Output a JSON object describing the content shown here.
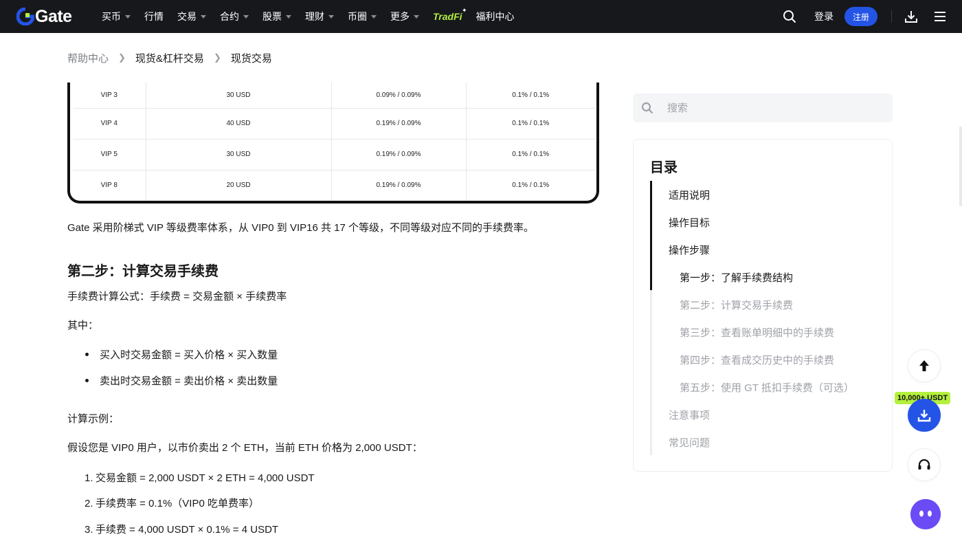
{
  "nav": {
    "brand": "Gate",
    "items": [
      {
        "label": "买币",
        "caret": true
      },
      {
        "label": "行情",
        "caret": false
      },
      {
        "label": "交易",
        "caret": true
      },
      {
        "label": "合约",
        "caret": true
      },
      {
        "label": "股票",
        "caret": true
      },
      {
        "label": "理财",
        "caret": true
      },
      {
        "label": "币圈",
        "caret": true
      },
      {
        "label": "更多",
        "caret": true
      }
    ],
    "tradfi": "TradFi",
    "welfare": "福利中心",
    "login": "登录",
    "register": "注册"
  },
  "breadcrumb": {
    "home": "帮助中心",
    "level1": "现货&杠杆交易",
    "level2": "现货交易"
  },
  "fee_table": {
    "rows": [
      [
        "VIP 3",
        "30 USD",
        "0.09% / 0.09%",
        "0.1% / 0.1%"
      ],
      [
        "VIP 4",
        "40 USD",
        "0.19% / 0.09%",
        "0.1% / 0.1%"
      ],
      [
        "VIP 5",
        "30 USD",
        "0.19% / 0.09%",
        "0.1% / 0.1%"
      ],
      [
        "VIP 8",
        "20 USD",
        "0.19% / 0.09%",
        "0.1% / 0.1%"
      ]
    ]
  },
  "article": {
    "intro": "Gate 采用阶梯式 VIP 等级费率体系，从 VIP0 到 VIP16 共 17 个等级，不同等级对应不同的手续费率。",
    "step2_heading": "第二步：计算交易手续费",
    "formula": "手续费计算公式：手续费 = 交易金额 × 手续费率",
    "where": "其中：",
    "bullets": [
      "买入时交易金额 = 买入价格 × 买入数量",
      "卖出时交易金额 = 卖出价格 × 卖出数量"
    ],
    "example_label": "计算示例：",
    "example_desc": "假设您是 VIP0 用户，以市价卖出 2 个 ETH，当前 ETH 价格为 2,000 USDT：",
    "steps": [
      "交易金额 = 2,000 USDT × 2 ETH = 4,000 USDT",
      "手续费率 = 0.1%（VIP0 吃单费率）",
      "手续费 = 4,000 USDT × 0.1% = 4 USDT"
    ]
  },
  "sidebar": {
    "search_placeholder": "搜索",
    "toc_title": "目录",
    "toc": [
      {
        "label": "适用说明",
        "level": 1,
        "state": "active"
      },
      {
        "label": "操作目标",
        "level": 1,
        "state": "active"
      },
      {
        "label": "操作步骤",
        "level": 1,
        "state": "active"
      },
      {
        "label": "第一步：了解手续费结构",
        "level": 2,
        "state": "active"
      },
      {
        "label": "第二步：计算交易手续费",
        "level": 2,
        "state": "inactive"
      },
      {
        "label": "第三步：查看账单明细中的手续费",
        "level": 2,
        "state": "inactive"
      },
      {
        "label": "第四步：查看成交历史中的手续费",
        "level": 2,
        "state": "inactive"
      },
      {
        "label": "第五步：使用 GT 抵扣手续费（可选）",
        "level": 2,
        "state": "inactive"
      },
      {
        "label": "注意事项",
        "level": 1,
        "state": "inactive"
      },
      {
        "label": "常见问题",
        "level": 1,
        "state": "inactive"
      }
    ]
  },
  "floating": {
    "promo": "10,000+ USDT"
  },
  "colors": {
    "nav_bg": "#17181c",
    "brand_blue": "#2354e6",
    "accent_green": "#b4f03c",
    "text_muted": "#9fa2a8"
  }
}
